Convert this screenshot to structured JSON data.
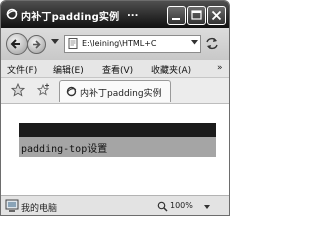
{
  "window": {
    "title": "内补丁padding实例",
    "title_ellipsis": "...",
    "buttons": [
      "minimize",
      "maximize",
      "close"
    ]
  },
  "navigation": {
    "address": "E:\\leining\\HTML+C",
    "icons": [
      "back-icon",
      "forward-icon",
      "page-icon",
      "refresh-icon"
    ]
  },
  "menu": {
    "items": [
      "文件(F)",
      "编辑(E)",
      "查看(V)",
      "收藏夹(A)"
    ],
    "more": "»"
  },
  "tabs": [
    {
      "label": "内补丁padding实例"
    }
  ],
  "content": {
    "demo_text": "padding-top设置"
  },
  "status": {
    "zone": "我的电脑",
    "zoom": "100%"
  }
}
